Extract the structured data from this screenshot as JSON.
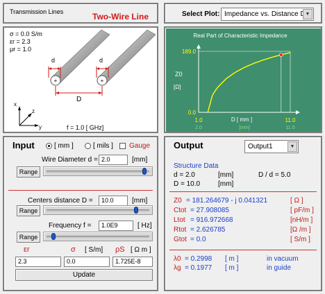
{
  "header": {
    "app_title": "Transmission Lines",
    "plot_name": "Two-Wire Line",
    "select_label": "Select Plot:",
    "select_value": "Impedance vs. Distance D"
  },
  "diagram": {
    "sigma_line": "σ  = 0.0 S/m",
    "eps_line": "εr = 2.3",
    "mu_line": "μr = 1.0",
    "dim_d1": "d",
    "dim_d2": "d",
    "dim_D": "D",
    "axis_x": "x",
    "axis_y": "y",
    "axis_z": "z",
    "frequency_text": "f = 1.0  [ GHz]"
  },
  "chart_data": {
    "type": "line",
    "title": "Real Part of Characteristic Impedance",
    "ylabel": "Z0",
    "yunit": "[Ω]",
    "xlabel": "D [ mm ]",
    "x_tick_labels": [
      "1.0",
      "11.0"
    ],
    "y_tick_labels": [
      "189.0",
      "0.0"
    ],
    "bottom_labels": [
      "2.0",
      "[mm]",
      "11.0"
    ],
    "xlim": [
      1.0,
      11.0
    ],
    "ylim": [
      0.0,
      189.0
    ],
    "marker_x": 10.0,
    "series": [
      {
        "x": [
          2.0,
          2.5,
          3.0,
          4.0,
          5.0,
          6.0,
          7.0,
          8.0,
          9.0,
          10.0,
          11.0
        ],
        "values": [
          0.0,
          52.7,
          74.8,
          104.1,
          124.0,
          139.2,
          151.4,
          161.7,
          170.5,
          178.3,
          185.2
        ]
      }
    ],
    "colors": {
      "line": "#ffff00",
      "marker": "#ff2020",
      "background": "#3f8e6e"
    }
  },
  "input": {
    "title": "Input",
    "unit_mm": "[ mm ]",
    "unit_mils": "[ mils ]",
    "gauge_label": "Gauge",
    "wire_diameter_label": "Wire Diameter  d =",
    "wire_diameter_value": "2.0",
    "wire_diameter_unit": "[mm]",
    "wire_diameter_pos": 0.96,
    "range_label": "Range",
    "centers_label": "Centers distance  D =",
    "centers_value": "10.0",
    "centers_unit": "[mm]",
    "centers_pos": 0.88,
    "frequency_label": "Frequency  f =",
    "frequency_value": "1.0E9",
    "frequency_unit": "[ Hz]",
    "frequency_pos": 0.06,
    "eps_label": "εr",
    "sigma_label": "σ",
    "sigma_unit": "[ S/m]",
    "rho_label": "ρS",
    "rho_unit": "[ Ω m ]",
    "eps_value": "2.3",
    "sigma_value": "0.0",
    "rho_value": "1.725E-8",
    "update_label": "Update"
  },
  "output": {
    "title": "Output",
    "select_value": "Output1",
    "structure_heading": "Structure Data",
    "d_line": "d    = 2.0",
    "d_unit": "[mm]",
    "ratio_line": "D / d  = 5.0",
    "D_line": "D   = 10.0",
    "D_unit": "[mm]",
    "z0_label": "Z0",
    "z0_value": "=  181.264679 - j 0.041321",
    "z0_unit": "[ Ω ]",
    "ctot_label": "Ctot",
    "ctot_value": "=  27.908085",
    "ctot_unit": "[ pF/m ]",
    "ltot_label": "Ltot",
    "ltot_value": "=  916.972668",
    "ltot_unit": "[nH/m ]",
    "rtot_label": "Rtot",
    "rtot_value": "=  2.626785",
    "rtot_unit": "[Ω /m ]",
    "gtot_label": "Gtot",
    "gtot_value": "=  0.0",
    "gtot_unit": "[ S/m ]",
    "lambda0_label": "λ0",
    "lambda0_value": "=  0.2998",
    "lambda0_unit": "[ m ]",
    "lambda0_note": "in vacuum",
    "lambdag_label": "λg",
    "lambdag_value": "=  0.1977",
    "lambdag_unit": "[ m ]",
    "lambdag_note": "in guide"
  }
}
